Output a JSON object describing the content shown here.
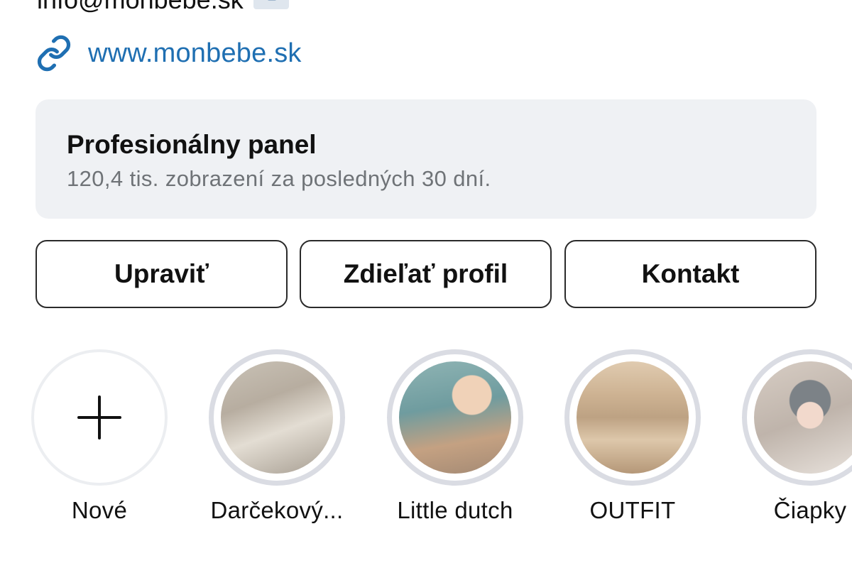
{
  "contact": {
    "email_text": "info@monbebe.sk",
    "email_icon": "email-icon",
    "website_icon": "link-icon",
    "website_text": "www.monbebe.sk",
    "link_color": "#1f6fb2"
  },
  "professional_panel": {
    "title": "Profesionálny panel",
    "subtitle": "120,4 tis. zobrazení za posledných 30 dní."
  },
  "actions": {
    "edit_label": "Upraviť",
    "share_label": "Zdieľať profil",
    "contact_label": "Kontakt"
  },
  "highlights": [
    {
      "label": "Nové",
      "icon": "plus-icon"
    },
    {
      "label": "Darčekový..."
    },
    {
      "label": "Little dutch"
    },
    {
      "label": "OUTFIT"
    },
    {
      "label": "Čiapky"
    }
  ]
}
